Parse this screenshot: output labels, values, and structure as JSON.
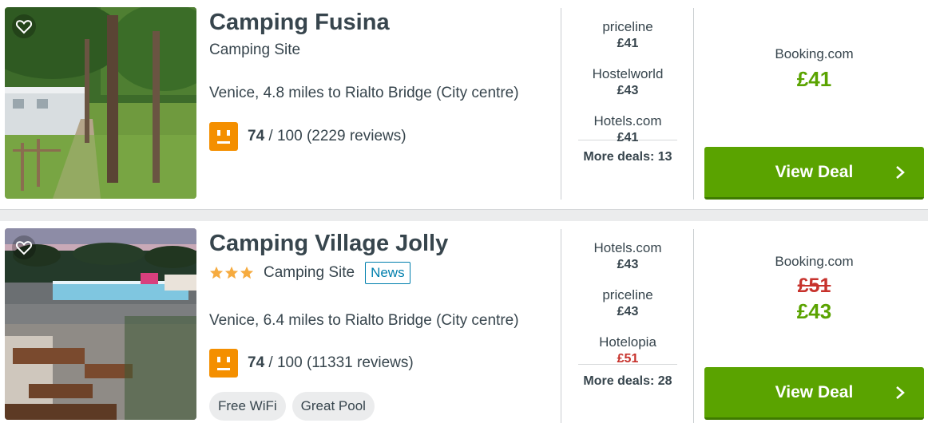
{
  "listings": [
    {
      "name": "Camping Fusina",
      "type": "Camping Site",
      "location": "Venice, 4.8 miles to Rialto Bridge (City centre)",
      "rating_score": "74",
      "rating_suffix": " / 100 (2229 reviews)",
      "deals": [
        {
          "site": "priceline",
          "price": "£41"
        },
        {
          "site": "Hostelworld",
          "price": "£43"
        },
        {
          "site": "Hotels.com",
          "price": "£41"
        }
      ],
      "more_deals": "More deals: 13",
      "best_site": "Booking.com",
      "best_price": "£41",
      "view_deal": "View Deal"
    },
    {
      "name": "Camping Village Jolly",
      "stars": 3,
      "type": "Camping Site",
      "badge": "News",
      "location": "Venice, 6.4 miles to Rialto Bridge (City centre)",
      "rating_score": "74",
      "rating_suffix": " / 100 (11331 reviews)",
      "amenities": [
        "Free WiFi",
        "Great Pool"
      ],
      "deals": [
        {
          "site": "Hotels.com",
          "price": "£43"
        },
        {
          "site": "priceline",
          "price": "£43"
        },
        {
          "site": "Hotelopia",
          "price": "£51"
        }
      ],
      "more_deals": "More deals: 28",
      "best_site": "Booking.com",
      "old_price": "£51",
      "best_price": "£43",
      "view_deal": "View Deal"
    }
  ],
  "icons": {
    "favorite": "heart-icon",
    "rating": "neutral-face-icon",
    "star": "star-icon",
    "chevron": "chevron-right-icon"
  },
  "colors": {
    "price_green": "#5aa300",
    "price_red": "#c7322c",
    "rating_orange": "#f48f00",
    "badge_blue": "#007fad"
  }
}
